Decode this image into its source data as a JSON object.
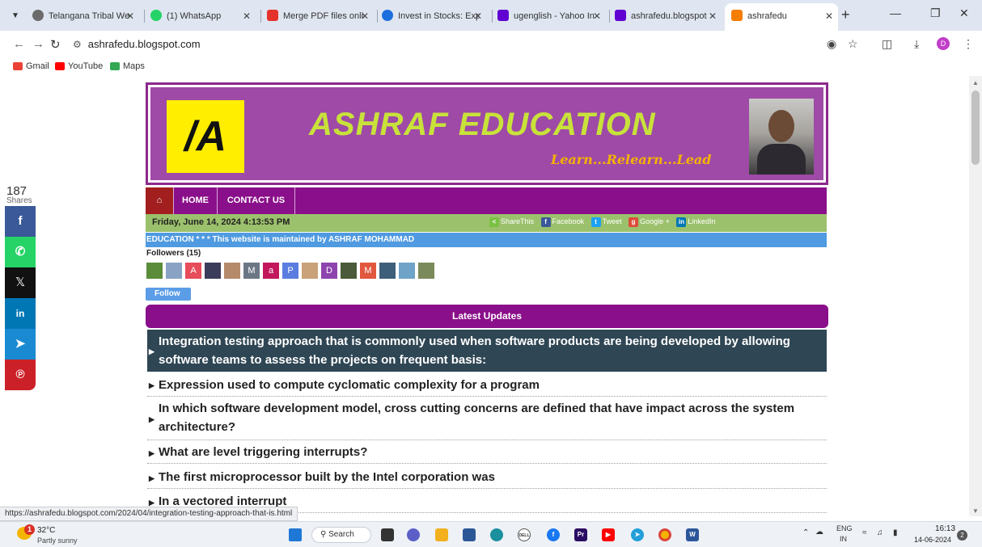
{
  "browser": {
    "tabs": [
      {
        "title": "Telangana Tribal Wel",
        "color": "#6b6b6b"
      },
      {
        "title": "(1) WhatsApp",
        "color": "#25d366"
      },
      {
        "title": "Merge PDF files onlir",
        "color": "#e5322d"
      },
      {
        "title": "Invest in Stocks: Exp",
        "color": "#1d6fe0"
      },
      {
        "title": "ugenglish - Yahoo In",
        "color": "#6001d2"
      },
      {
        "title": "ashrafedu.blogspot",
        "color": "#6001d2"
      },
      {
        "title": "ashrafedu",
        "color": "#f57d00"
      }
    ],
    "url": "ashrafedu.blogspot.com",
    "bookmarks": [
      {
        "label": "Gmail",
        "color": "#ea4335"
      },
      {
        "label": "YouTube",
        "color": "#ff0000"
      },
      {
        "label": "Maps",
        "color": "#34a853"
      }
    ],
    "profile_initial": "D",
    "status_url": "https://ashrafedu.blogspot.com/2024/04/integration-testing-approach-that-is.html"
  },
  "share": {
    "count": "187",
    "label": "Shares",
    "buttons": [
      {
        "name": "facebook",
        "glyph": "f",
        "color": "#3b5998"
      },
      {
        "name": "whatsapp",
        "glyph": "✆",
        "color": "#25d366"
      },
      {
        "name": "x",
        "glyph": "𝕏",
        "color": "#111111"
      },
      {
        "name": "linkedin",
        "glyph": "in",
        "color": "#0077b5"
      },
      {
        "name": "telegram",
        "glyph": "➤",
        "color": "#1a8ad2"
      },
      {
        "name": "pinterest",
        "glyph": "℗",
        "color": "#cb2027"
      }
    ]
  },
  "site": {
    "logo_text": "/A",
    "title": "ASHRAF EDUCATION",
    "tagline": "Learn...Relearn...Lead",
    "nav": {
      "home_icon": "⌂",
      "home": "HOME",
      "contact": "CONTACT US"
    },
    "date_time": "Friday, June 14, 2024 4:13:53 PM",
    "share_links": [
      {
        "label": "ShareThis",
        "color": "#7ac143",
        "glyph": "<"
      },
      {
        "label": "Facebook",
        "color": "#3b5998",
        "glyph": "f"
      },
      {
        "label": "Tweet",
        "color": "#1da1f2",
        "glyph": "t"
      },
      {
        "label": "Google +",
        "color": "#dd4b39",
        "glyph": "g"
      },
      {
        "label": "LinkedIn",
        "color": "#0077b5",
        "glyph": "in"
      }
    ],
    "ticker": "EDUCATION * * * This website is maintained by ASHRAF MOHAMMAD",
    "followers_label": "Followers (15)",
    "follow_button": "Follow",
    "follower_avatars": [
      {
        "letter": "",
        "color": "#5b8c3a"
      },
      {
        "letter": "",
        "color": "#8aa3c4"
      },
      {
        "letter": "A",
        "color": "#e74c5a"
      },
      {
        "letter": "",
        "color": "#3b3b5a"
      },
      {
        "letter": "",
        "color": "#b58a6b"
      },
      {
        "letter": "M",
        "color": "#6b7785"
      },
      {
        "letter": "a",
        "color": "#c2185b"
      },
      {
        "letter": "P",
        "color": "#5b7de0"
      },
      {
        "letter": "",
        "color": "#c9a27a"
      },
      {
        "letter": "D",
        "color": "#8e44ad"
      },
      {
        "letter": "",
        "color": "#4a5a3a"
      },
      {
        "letter": "M",
        "color": "#e2583e"
      },
      {
        "letter": "",
        "color": "#3e5f7a"
      },
      {
        "letter": "",
        "color": "#6fa3c8"
      },
      {
        "letter": "",
        "color": "#7a8a5a"
      }
    ],
    "updates_heading": "Latest Updates",
    "posts": [
      "Integration testing approach that is commonly used when software products are being developed by allowing software teams to assess the projects on frequent basis:",
      "Expression used to compute cyclomatic complexity for a program",
      "In which software development model, cross cutting concerns are defined that have impact across the system architecture?",
      "What are level triggering interrupts?",
      "The first microprocessor built by the Intel corporation was",
      "In a vectored interrupt"
    ]
  },
  "taskbar": {
    "weather_badge": "1",
    "temperature": "32°C",
    "weather": "Partly sunny",
    "search_label": "Search",
    "lang": "ENG",
    "region": "IN",
    "time": "16:13",
    "date": "14-06-2024",
    "notifications": "2",
    "apps": [
      {
        "name": "task-view",
        "color": "#333333",
        "glyph": ""
      },
      {
        "name": "chat",
        "color": "#5b5fc7",
        "glyph": ""
      },
      {
        "name": "file-explorer",
        "color": "#f2b01e",
        "glyph": ""
      },
      {
        "name": "store",
        "color": "#2b5797",
        "glyph": ""
      },
      {
        "name": "edge",
        "color": "#1a8f9e",
        "glyph": ""
      },
      {
        "name": "dell",
        "color": "#ffffff",
        "glyph": "DELL"
      },
      {
        "name": "facebook",
        "color": "#1877f2",
        "glyph": "f"
      },
      {
        "name": "premiere",
        "color": "#2a0b63",
        "glyph": "Pr"
      },
      {
        "name": "youtube",
        "color": "#ff0000",
        "glyph": "▶"
      },
      {
        "name": "telegram",
        "color": "#229ed9",
        "glyph": "➤"
      },
      {
        "name": "chrome",
        "color": "#f4b400",
        "glyph": ""
      },
      {
        "name": "word",
        "color": "#2b579a",
        "glyph": "W"
      }
    ]
  }
}
